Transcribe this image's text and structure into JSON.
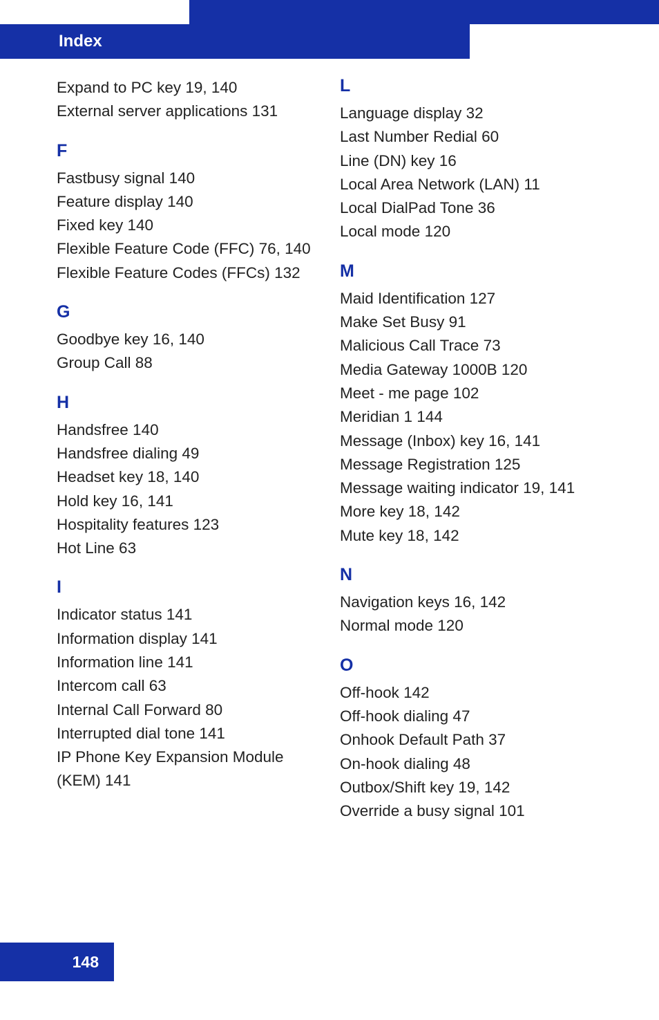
{
  "header": "Index",
  "pageNumber": "148",
  "left": {
    "pre": [
      "Expand to PC key 19, 140",
      "External server applications 131"
    ],
    "sections": [
      {
        "letter": "F",
        "items": [
          "Fastbusy signal 140",
          "Feature display 140",
          "Fixed key 140",
          "Flexible Feature Code (FFC) 76, 140",
          "Flexible Feature Codes (FFCs) 132"
        ]
      },
      {
        "letter": "G",
        "items": [
          "Goodbye key 16, 140",
          "Group Call 88"
        ]
      },
      {
        "letter": "H",
        "items": [
          "Handsfree 140",
          "Handsfree dialing 49",
          "Headset key 18, 140",
          "Hold key 16, 141",
          "Hospitality features 123",
          "Hot Line 63"
        ]
      },
      {
        "letter": "I",
        "items": [
          "Indicator status 141",
          "Information display 141",
          "Information line 141",
          "Intercom call 63",
          "Internal Call Forward 80",
          "Interrupted dial tone 141",
          "IP Phone Key Expansion Module (KEM) 141"
        ]
      }
    ]
  },
  "right": {
    "sections": [
      {
        "letter": "L",
        "items": [
          "Language display 32",
          "Last Number Redial 60",
          "Line (DN) key 16",
          "Local Area Network (LAN) 11",
          "Local DialPad Tone 36",
          "Local mode 120"
        ]
      },
      {
        "letter": "M",
        "items": [
          "Maid Identification 127",
          "Make Set Busy 91",
          "Malicious Call Trace 73",
          "Media Gateway 1000B 120",
          "Meet - me page 102",
          "Meridian 1 144",
          "Message (Inbox) key 16, 141",
          "Message Registration 125",
          "Message waiting indicator 19, 141",
          "More key 18, 142",
          "Mute key 18, 142"
        ]
      },
      {
        "letter": "N",
        "items": [
          "Navigation keys 16, 142",
          "Normal mode 120"
        ]
      },
      {
        "letter": "O",
        "items": [
          "Off-hook 142",
          "Off-hook dialing 47",
          "Onhook Default Path 37",
          "On-hook dialing 48",
          "Outbox/Shift key 19, 142",
          "Override a busy signal 101"
        ]
      }
    ]
  }
}
